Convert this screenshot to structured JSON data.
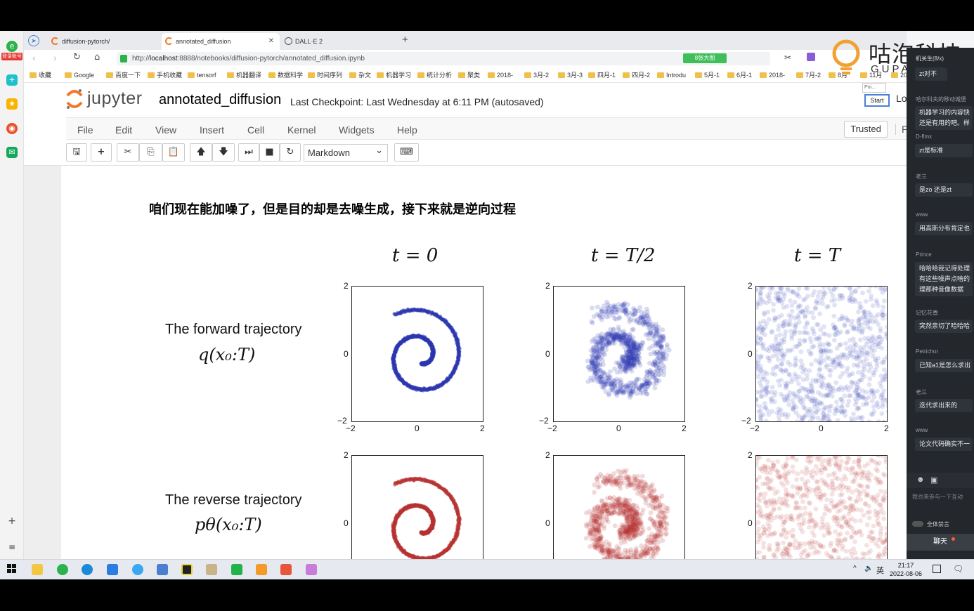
{
  "browser": {
    "tabs": [
      {
        "label": "diffusion-pytorch/",
        "active": false
      },
      {
        "label": "annotated_diffusion",
        "active": true
      },
      {
        "label": "DALL·E 2",
        "active": false
      }
    ],
    "new_tab": "+",
    "url_prefix": "http://",
    "url_host": "localhost",
    "url_rest": ":8888/notebooks/diffusion-pytorch/annotated_diffusion.ipynb",
    "badge_label": "8张大图",
    "left_rail_badge": "登录账号",
    "bookmarks": [
      "收藏",
      "Google",
      "百度一下",
      "手机收藏",
      "tensorf",
      "机器翻译",
      "数据科学",
      "时间序列",
      "杂文",
      "机器学习",
      "统计分析",
      "聚类",
      "2018-",
      "3月-2",
      "3月-3",
      "四月-1",
      "四月-2",
      "Introdu",
      "5月-1",
      "6月-1",
      "2018-",
      "7月-2",
      "8月",
      "11月",
      "20"
    ]
  },
  "jupyter": {
    "logo_text": "jupyter",
    "notebook_name": "annotated_diffusion",
    "checkpoint": "Last Checkpoint: Last Wednesday at 6:11 PM (autosaved)",
    "menu": [
      "File",
      "Edit",
      "View",
      "Insert",
      "Cell",
      "Kernel",
      "Widgets",
      "Help"
    ],
    "trusted": "Trusted",
    "kernel": "Python",
    "cell_type": "Markdown",
    "logout_partial": "Lo",
    "popup_start": "Start",
    "popup_label": "Poi..."
  },
  "notebook": {
    "heading": "咱们现在能加噪了，但是目的却是去噪生成，接下来就是逆向过程",
    "col_titles": [
      "t = 0",
      "t = T/2",
      "t = T"
    ],
    "row_labels": [
      "The forward trajectory",
      "The reverse trajectory"
    ],
    "row_math": [
      "q(x₀:T)",
      "pθ(x₀:T)"
    ],
    "tick_labels": {
      "y_top": "2",
      "y_mid": "0",
      "y_bot": "−2",
      "x_left": "−2",
      "x_mid": "0",
      "x_right": "2"
    },
    "colors": {
      "forward": "#2b36b0",
      "reverse": "#b83232"
    }
  },
  "chat": {
    "top_partial": "zt对不",
    "header_partial": "机关生(8/x)",
    "messages": [
      {
        "name": "哈尔科夫的移动城堡",
        "text": "机器学习的内容快\n还是有用的吧。样"
      },
      {
        "name": "D-flmx",
        "text": "zt是标准"
      },
      {
        "name": "老三",
        "text": "是zo 还是zt"
      },
      {
        "name": "www",
        "text": "用高斯分布肯定也"
      },
      {
        "name": "Prince",
        "text": "哈哈哈我记得处理\n有这些噪声点啥的\n理那种音像数据"
      },
      {
        "name": "记忆花香",
        "text": "突然亲切了哈哈哈"
      },
      {
        "name": "Petrichor",
        "text": "已知a1是怎么求出"
      },
      {
        "name": "老三",
        "text": "迭代求出来的"
      },
      {
        "name": "www",
        "text": "论文代码确实不一"
      }
    ],
    "input_placeholder": "我也来参与一下互动",
    "mute_all": "全体禁言",
    "chat_tab": "聊天"
  },
  "watermark": {
    "text": "咕泡科技",
    "sub": "GUPA"
  },
  "taskbar": {
    "time": "21:17",
    "date": "2022-08-06",
    "ime": "英"
  }
}
